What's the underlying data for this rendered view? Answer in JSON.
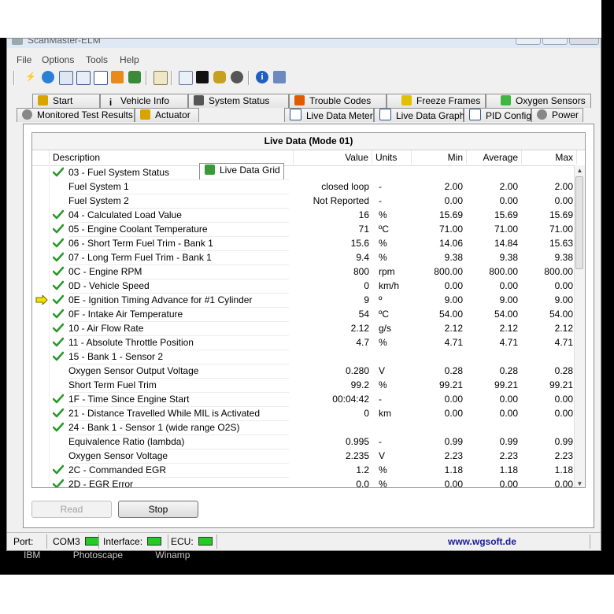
{
  "window": {
    "title": "ScanMaster-ELM"
  },
  "menu": [
    "File",
    "Options",
    "Tools",
    "Help"
  ],
  "tabs_row1": [
    "Start",
    "Vehicle Info",
    "System Status",
    "Trouble Codes",
    "Freeze Frames",
    "Oxygen Sensors"
  ],
  "tabs_row2": [
    "Monitored Test Results",
    "Actuator",
    "Live Data Grid",
    "Live Data Meter",
    "Live Data Graph",
    "PID Config",
    "Power"
  ],
  "grid": {
    "title": "Live Data (Mode 01)",
    "headers": {
      "desc": "Description",
      "value": "Value",
      "units": "Units",
      "min": "Min",
      "avg": "Average",
      "max": "Max"
    },
    "rows": [
      {
        "check": true,
        "desc": "03 - Fuel System Status",
        "value": "",
        "unit": "",
        "min": "",
        "avg": "",
        "max": ""
      },
      {
        "check": false,
        "desc": "Fuel System 1",
        "value": "closed loop",
        "unit": "-",
        "min": "2.00",
        "avg": "2.00",
        "max": "2.00"
      },
      {
        "check": false,
        "desc": "Fuel System 2",
        "value": "Not Reported",
        "unit": "-",
        "min": "0.00",
        "avg": "0.00",
        "max": "0.00"
      },
      {
        "check": true,
        "desc": "04 - Calculated Load Value",
        "value": "16",
        "unit": "%",
        "min": "15.69",
        "avg": "15.69",
        "max": "15.69"
      },
      {
        "check": true,
        "desc": "05 - Engine Coolant Temperature",
        "value": "71",
        "unit": "ºC",
        "min": "71.00",
        "avg": "71.00",
        "max": "71.00"
      },
      {
        "check": true,
        "desc": "06 - Short Term Fuel Trim - Bank 1",
        "value": "15.6",
        "unit": "%",
        "min": "14.06",
        "avg": "14.84",
        "max": "15.63"
      },
      {
        "check": true,
        "desc": "07 - Long Term Fuel Trim - Bank 1",
        "value": "9.4",
        "unit": "%",
        "min": "9.38",
        "avg": "9.38",
        "max": "9.38"
      },
      {
        "check": true,
        "desc": "0C - Engine RPM",
        "value": "800",
        "unit": "rpm",
        "min": "800.00",
        "avg": "800.00",
        "max": "800.00"
      },
      {
        "check": true,
        "desc": "0D - Vehicle Speed",
        "value": "0",
        "unit": "km/h",
        "min": "0.00",
        "avg": "0.00",
        "max": "0.00"
      },
      {
        "check": true,
        "arrow": true,
        "desc": "0E - Ignition Timing Advance for #1 Cylinder",
        "value": "9",
        "unit": "º",
        "min": "9.00",
        "avg": "9.00",
        "max": "9.00"
      },
      {
        "check": true,
        "desc": "0F - Intake Air Temperature",
        "value": "54",
        "unit": "ºC",
        "min": "54.00",
        "avg": "54.00",
        "max": "54.00"
      },
      {
        "check": true,
        "desc": "10 - Air Flow Rate",
        "value": "2.12",
        "unit": "g/s",
        "min": "2.12",
        "avg": "2.12",
        "max": "2.12"
      },
      {
        "check": true,
        "desc": "11 - Absolute Throttle Position",
        "value": "4.7",
        "unit": "%",
        "min": "4.71",
        "avg": "4.71",
        "max": "4.71"
      },
      {
        "check": true,
        "desc": "15 - Bank 1 - Sensor 2",
        "value": "",
        "unit": "",
        "min": "",
        "avg": "",
        "max": ""
      },
      {
        "check": false,
        "desc": "Oxygen Sensor Output Voltage",
        "value": "0.280",
        "unit": "V",
        "min": "0.28",
        "avg": "0.28",
        "max": "0.28"
      },
      {
        "check": false,
        "desc": "Short Term Fuel Trim",
        "value": "99.2",
        "unit": "%",
        "min": "99.21",
        "avg": "99.21",
        "max": "99.21"
      },
      {
        "check": true,
        "desc": "1F - Time Since Engine Start",
        "value": "00:04:42",
        "unit": "-",
        "min": "0.00",
        "avg": "0.00",
        "max": "0.00"
      },
      {
        "check": true,
        "desc": "21 - Distance Travelled While MIL is Activated",
        "value": "0",
        "unit": "km",
        "min": "0.00",
        "avg": "0.00",
        "max": "0.00"
      },
      {
        "check": true,
        "desc": "24 - Bank 1 - Sensor 1 (wide range O2S)",
        "value": "",
        "unit": "",
        "min": "",
        "avg": "",
        "max": ""
      },
      {
        "check": false,
        "desc": "Equivalence Ratio (lambda)",
        "value": "0.995",
        "unit": "-",
        "min": "0.99",
        "avg": "0.99",
        "max": "0.99"
      },
      {
        "check": false,
        "desc": "Oxygen Sensor Voltage",
        "value": "2.235",
        "unit": "V",
        "min": "2.23",
        "avg": "2.23",
        "max": "2.23"
      },
      {
        "check": true,
        "desc": "2C - Commanded EGR",
        "value": "1.2",
        "unit": "%",
        "min": "1.18",
        "avg": "1.18",
        "max": "1.18"
      },
      {
        "check": true,
        "desc": "2D - EGR Error",
        "value": "0.0",
        "unit": "%",
        "min": "0.00",
        "avg": "0.00",
        "max": "0.00"
      }
    ]
  },
  "buttons": {
    "read": "Read",
    "stop": "Stop"
  },
  "status": {
    "port_label": "Port:",
    "port_value": "COM3",
    "interface_label": "Interface:",
    "ecu_label": "ECU:",
    "link": "www.wgsoft.de",
    "led_color": "#22cc22"
  },
  "taskbar": [
    "IBM",
    "Photoscape",
    "Winamp"
  ]
}
